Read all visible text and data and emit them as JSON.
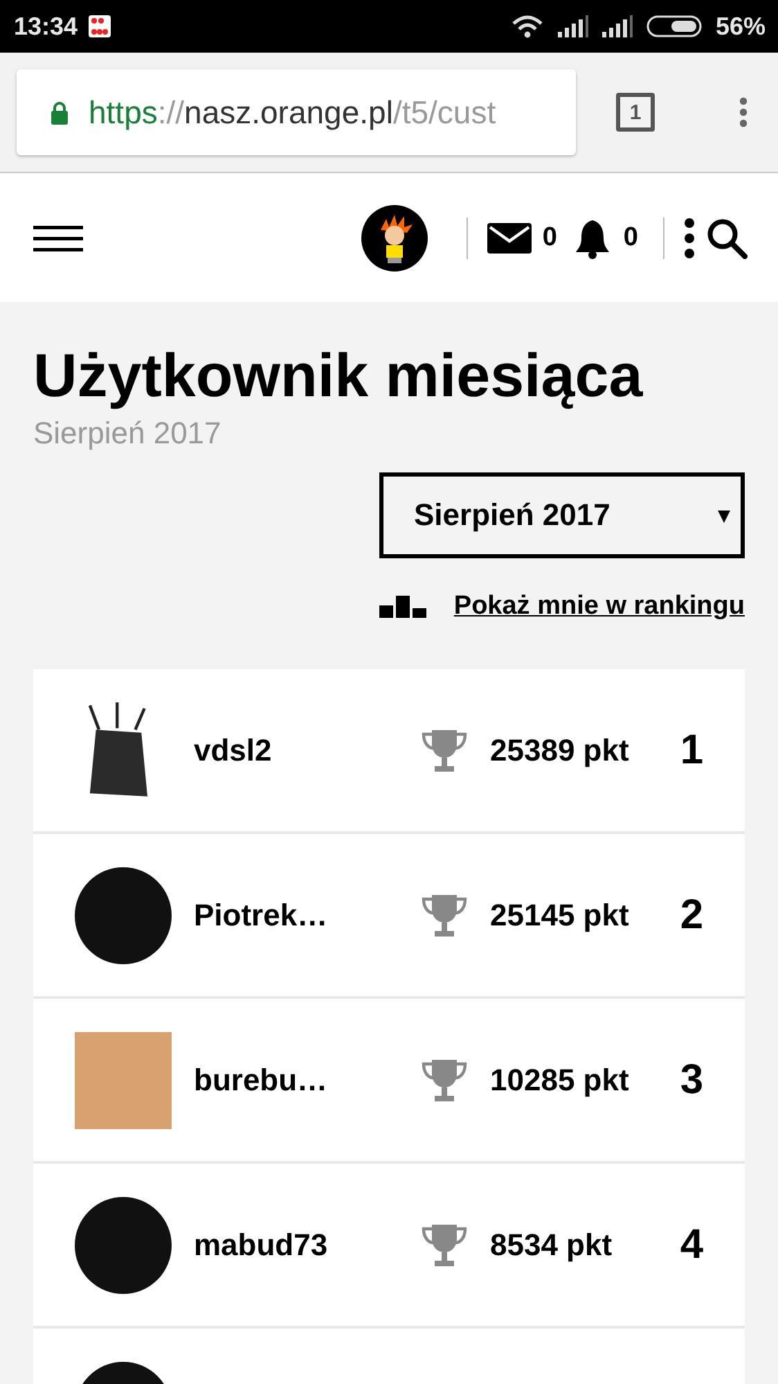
{
  "status_bar": {
    "time": "13:34",
    "battery": "56%"
  },
  "browser": {
    "url_scheme": "https",
    "url_separator": "://",
    "url_host": "nasz.orange.pl",
    "url_path": "/t5/cust",
    "tab_count": "1"
  },
  "header": {
    "messages_count": "0",
    "notifications_count": "0"
  },
  "page": {
    "title": "Użytkownik miesiąca",
    "subtitle": "Sierpień 2017",
    "month_select": {
      "value": "Sierpień 2017",
      "arrow": "▾"
    },
    "show_me_link": "Pokaż mnie w rankingu"
  },
  "ranking": [
    {
      "kind": "router",
      "name": "vdsl2",
      "points": "25389 pkt",
      "rank": "1"
    },
    {
      "kind": "round",
      "name": "Piotrek…",
      "points": "25145 pkt",
      "rank": "2"
    },
    {
      "kind": "square",
      "name": "burebu…",
      "points": "10285 pkt",
      "rank": "3"
    },
    {
      "kind": "round",
      "name": "mabud73",
      "points": "8534 pkt",
      "rank": "4"
    },
    {
      "kind": "round"
    }
  ]
}
